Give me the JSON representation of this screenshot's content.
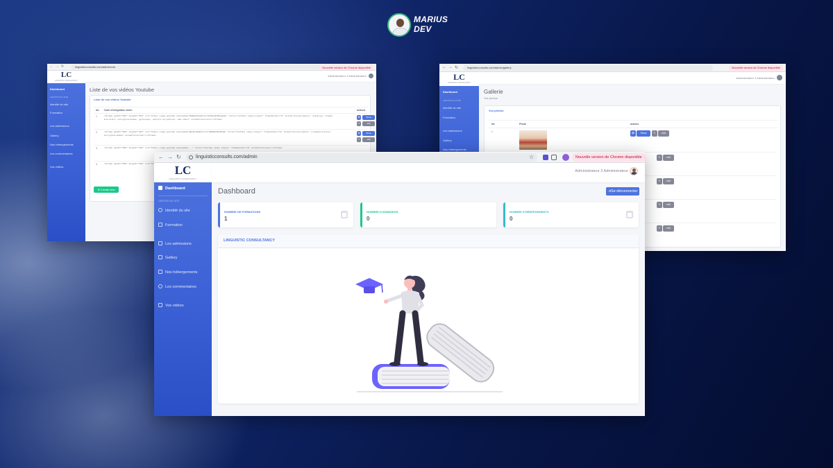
{
  "brand": {
    "name_line1": "MARIUS",
    "name_line2": "DEV"
  },
  "shared": {
    "logo_text": "LC",
    "logo_sub": "LINGUISTIC CONSULTANCY",
    "admin_label": "Administrateur 3 Administrateur",
    "chrome_badge": "Nouvelle version de Chrome disponible",
    "sidebar_heading": "GESTION DU SITE"
  },
  "window_videos": {
    "url": "linguisticconsults.com/admin/voir",
    "sidebar": [
      "Dashboard",
      "Identité du site",
      "Formation",
      "Les admissions",
      "Gallery",
      "Nos hébergements",
      "Les commentaires",
      "Vos vidéos"
    ],
    "page_title": "Liste de vos vidéos Youtube",
    "card_title": "Liste de vos vidéos Youtube",
    "columns": [
      "No",
      "Code d'intégration vidéo",
      "actions"
    ],
    "rows": [
      {
        "no": "1",
        "code": "<iframe width=\"560\" height=\"315\" src=\"https://www.youtube.com/embed/tKWZq9Y0sEU?si=3FYQnpRrM8j8pSe\" title=\"YouTube video player\" frameborder=\"0\" allow=\"accelerometer; autoplay; clipboard-write; encrypted-media; gyroscope; picture-in-picture; web-share\" allowfullscreen></iframe>"
      },
      {
        "no": "2",
        "code": "<iframe width=\"560\" height=\"315\" src=\"https://www.youtube.com/embed/wBv3Xl8mH0Jr?si=7BPQ9VIH2P4jB\" title=\"YouTube video player\" frameborder=\"0\" allow=\"accelerometer; clipboard-write; encrypted-media\" allowfullscreen></iframe>"
      },
      {
        "no": "3",
        "code": "<iframe width=\"560\" height=\"315\" src=\"https://www.youtube.com/embed/...\" title=\"YouTube video player\" frameborder=\"0\" allowfullscreen></iframe>"
      },
      {
        "no": "4",
        "code": "<iframe width=\"560\" height=\"315\" src=\"https://www.youtube.com/embed/...\" title=\"YouTube video player\" frameborder=\"0\" allowfullscreen></iframe>"
      }
    ],
    "show_label": "Show",
    "edit_label": "edit",
    "create_label": "Create new"
  },
  "window_gallery": {
    "url": "linguisticconsults.com/admin/gallery",
    "sidebar": [
      "Dashboard",
      "Identité du site",
      "Formation",
      "Les admissions",
      "Gallery",
      "Nos hébergements",
      "Les commentaires"
    ],
    "page_title": "Gallerie",
    "page_sub": "Vos photos",
    "card_title": "Vos photos",
    "columns": [
      "No",
      "Photo",
      "actions"
    ],
    "rows": [
      {
        "no": "1"
      }
    ],
    "show_label": "Show",
    "edit_label": "edit"
  },
  "window_main": {
    "url": "linguisticconsults.com/admin",
    "sidebar": {
      "dashboard": "Dashboard",
      "identite": "Identité du site",
      "formation": "Formation",
      "admissions": "Les admissions",
      "gallery": "Gallery",
      "hebergements": "Nos hébergements",
      "commentaires": "Les commentaires",
      "videos": "Vos vidéos"
    },
    "page_title": "Dashboard",
    "logout_label": "Se déconnecter",
    "stats": [
      {
        "label": "NOMBRE DE FORMATIONS",
        "value": "1",
        "color": "#4e73df"
      },
      {
        "label": "NOMBRE D'ADMISSION",
        "value": "0",
        "color": "#1cc88a"
      },
      {
        "label": "NOMBRE D'HÉBERGEMENTS",
        "value": "0",
        "color": "#36b9cc"
      }
    ],
    "card_title": "LINGUISTIC CONSULTANCY"
  },
  "colors": {
    "primary": "#4e73df",
    "success": "#1cc88a",
    "info": "#36b9cc",
    "illustration_purple": "#6c63ff"
  }
}
